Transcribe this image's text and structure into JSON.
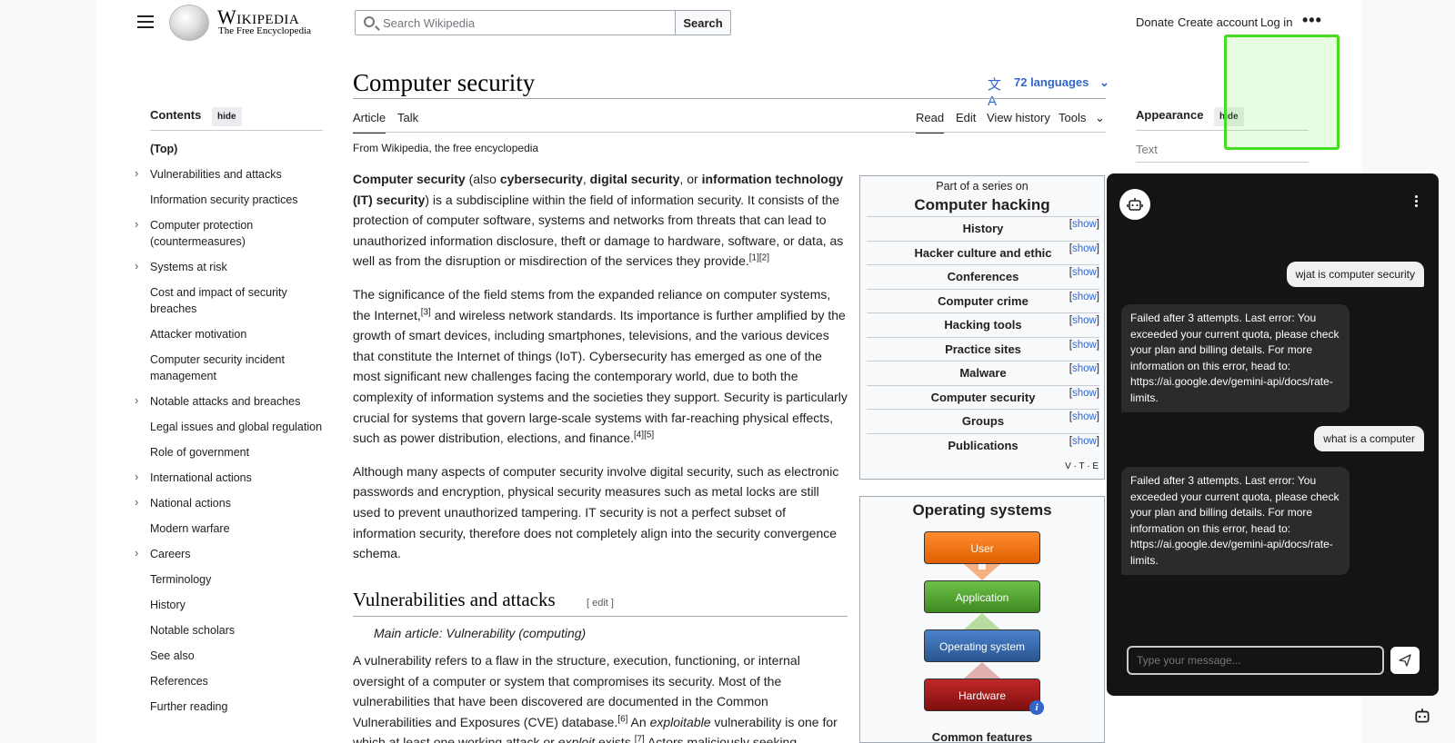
{
  "header": {
    "wordmark": "Wikipedia",
    "tagline": "The Free Encyclopedia",
    "search_placeholder": "Search Wikipedia",
    "search_button": "Search",
    "links": [
      "Donate",
      "Create account",
      "Log in"
    ]
  },
  "article": {
    "title": "Computer security",
    "languages": "72 languages",
    "tabs_left": [
      "Article",
      "Talk"
    ],
    "tabs_right": [
      "Read",
      "Edit",
      "View history",
      "Tools"
    ],
    "from": "From Wikipedia, the free encyclopedia",
    "section_heading": "Vulnerabilities and attacks",
    "section_edit": "[ edit ]",
    "hatnote": "Main article: Vulnerability (computing)"
  },
  "toc": {
    "heading": "Contents",
    "hide_label": "hide",
    "items": [
      {
        "label": "(Top)",
        "expandable": false
      },
      {
        "label": "Vulnerabilities and attacks",
        "expandable": true
      },
      {
        "label": "Information security practices",
        "expandable": false
      },
      {
        "label": "Computer protection (countermeasures)",
        "expandable": true
      },
      {
        "label": "Systems at risk",
        "expandable": true
      },
      {
        "label": "Cost and impact of security breaches",
        "expandable": false
      },
      {
        "label": "Attacker motivation",
        "expandable": false
      },
      {
        "label": "Computer security incident management",
        "expandable": false
      },
      {
        "label": "Notable attacks and breaches",
        "expandable": true
      },
      {
        "label": "Legal issues and global regulation",
        "expandable": false
      },
      {
        "label": "Role of government",
        "expandable": false
      },
      {
        "label": "International actions",
        "expandable": true
      },
      {
        "label": "National actions",
        "expandable": true
      },
      {
        "label": "Modern warfare",
        "expandable": false
      },
      {
        "label": "Careers",
        "expandable": true
      },
      {
        "label": "Terminology",
        "expandable": false
      },
      {
        "label": "History",
        "expandable": false
      },
      {
        "label": "Notable scholars",
        "expandable": false
      },
      {
        "label": "See also",
        "expandable": false
      },
      {
        "label": "References",
        "expandable": false
      },
      {
        "label": "Further reading",
        "expandable": false
      }
    ]
  },
  "navbox": {
    "series_label": "Part of a series on",
    "series_title": "Computer hacking",
    "show_label": "show",
    "rows": [
      "History",
      "Hacker culture and ethic",
      "Conferences",
      "Computer crime",
      "Hacking tools",
      "Practice sites",
      "Malware",
      "Computer security",
      "Groups",
      "Publications"
    ],
    "vte": "V · T · E"
  },
  "osbox": {
    "title": "Operating systems",
    "layers": [
      "User",
      "Application",
      "Operating system",
      "Hardware"
    ],
    "footer": "Common features",
    "colors": {
      "user": "#f07818",
      "application": "#5aa83a",
      "os": "#3a6cb0",
      "hardware": "#a01818"
    }
  },
  "appearance": {
    "heading": "Appearance",
    "hide_label": "hide",
    "text_label": "Text"
  },
  "chat": {
    "input_placeholder": "Type your message...",
    "messages": [
      {
        "role": "user",
        "text": "wjat is computer security"
      },
      {
        "role": "bot",
        "text": "Failed after 3 attempts. Last error: You exceeded your current quota, please check your plan and billing details. For more information on this error, head to: https://ai.google.dev/gemini-api/docs/rate-limits."
      },
      {
        "role": "user",
        "text": "what is a computer"
      },
      {
        "role": "bot",
        "text": "Failed after 3 attempts. Last error: You exceeded your current quota, please check your plan and billing details. For more information on this error, head to: https://ai.google.dev/gemini-api/docs/rate-limits."
      }
    ]
  },
  "colors": {
    "link": "#3366cc",
    "highlight": "#44dd22",
    "chat_bg": "#141414"
  }
}
